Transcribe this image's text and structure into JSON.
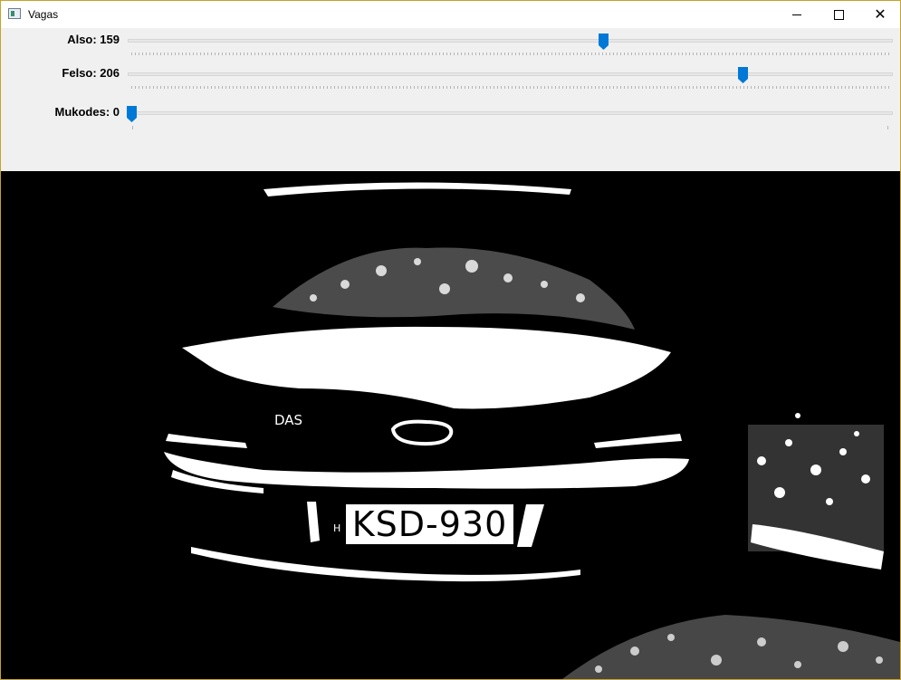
{
  "window": {
    "title": "Vagas",
    "icons": {
      "app": "window-app-icon",
      "minimize": "minimize-icon",
      "maximize": "maximize-icon",
      "close": "close-icon"
    },
    "close_glyph": "✕"
  },
  "trackbars": [
    {
      "label": "Also: 159",
      "value": 159,
      "max": 255
    },
    {
      "label": "Felso: 206",
      "value": 206,
      "max": 255
    },
    {
      "label": "Mukodes: 0",
      "value": 0,
      "max": 1
    }
  ],
  "image": {
    "plate_text": "KSD-930",
    "badge_text": "DAS",
    "plate_mark": "H"
  },
  "colors": {
    "accent": "#0078d7",
    "image_background": "#000000",
    "window_border": "#c9a227"
  }
}
